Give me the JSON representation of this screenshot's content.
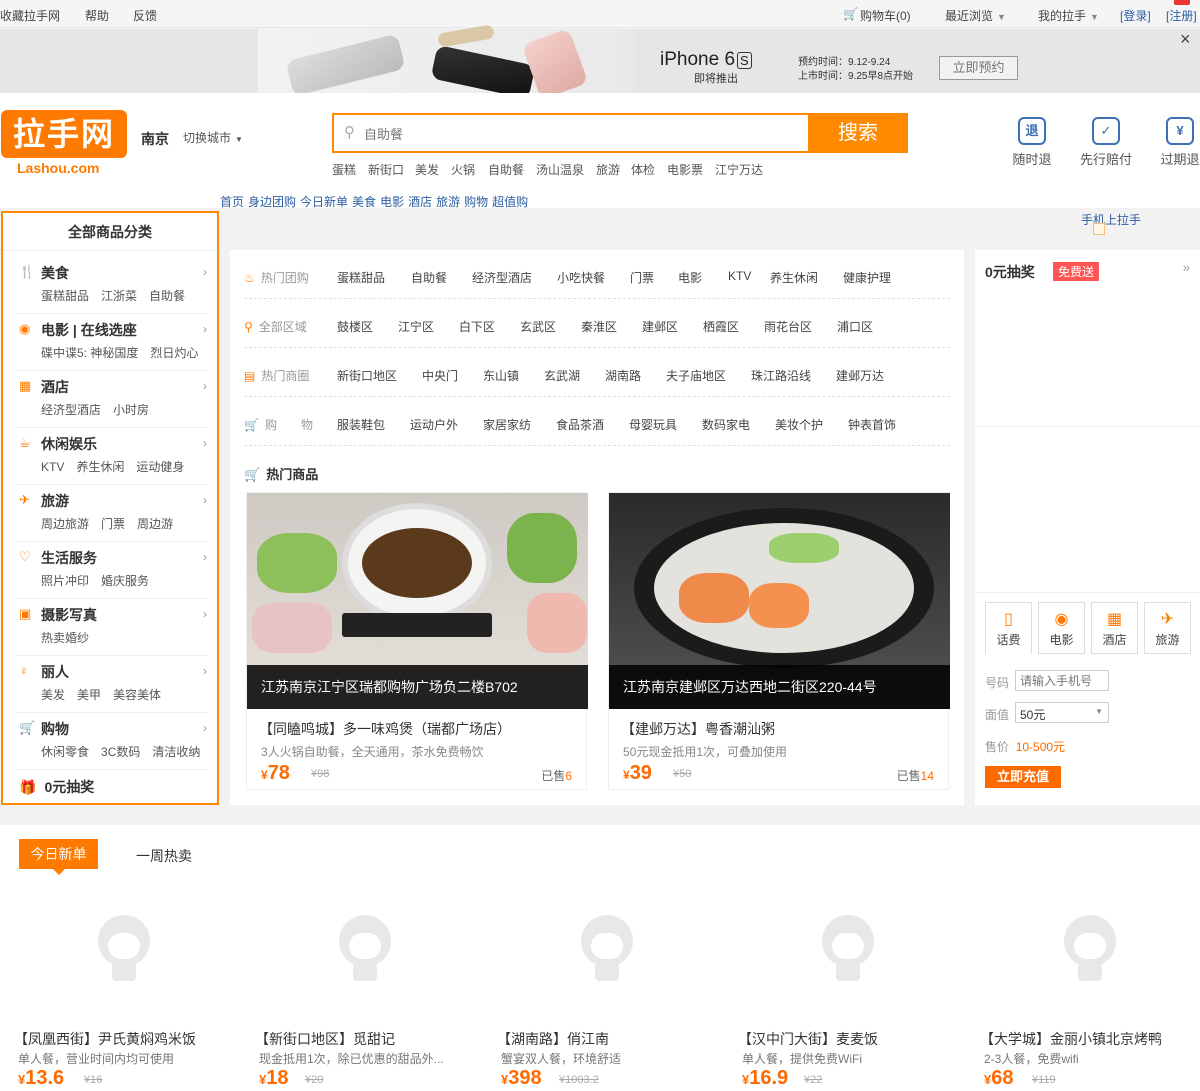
{
  "topbar": {
    "fav": "收藏拉手网",
    "help": "帮助",
    "feedback": "反馈",
    "cart": "购物车(0)",
    "recent": "最近浏览",
    "mine": "我的拉手",
    "login": "[登录]",
    "register": "[注册]",
    "close": "×"
  },
  "banner": {
    "phone": "iPhone 6",
    "phone_s": "S",
    "launch": "即将推出",
    "pre": "预约时间：9.12-9.24",
    "sale": "上市时间：9.25早8点开始",
    "reserve": "立即预约"
  },
  "logo": {
    "mark": "拉手网",
    "sub": "Lashou.com"
  },
  "city": {
    "name": "南京",
    "switch": "切换城市"
  },
  "search": {
    "placeholder": "自助餐",
    "button": "搜索"
  },
  "hot_keywords": [
    "蛋糕",
    "新街口",
    "美发",
    "火锅",
    "自助餐",
    "汤山温泉",
    "旅游",
    "体检",
    "电影票",
    "江宁万达"
  ],
  "nav": [
    "首页",
    "身边团购",
    "今日新单",
    "美食",
    "电影",
    "酒店",
    "旅游",
    "购物",
    "超值购"
  ],
  "guarantees": [
    "随时退",
    "先行赔付",
    "过期退"
  ],
  "mobile_link": "手机上拉手",
  "sidebar": {
    "title": "全部商品分类",
    "cats": [
      {
        "name": "美食",
        "subs": [
          "蛋糕甜品",
          "江浙菜",
          "自助餐"
        ]
      },
      {
        "name": "电影 | 在线选座",
        "subs": [
          "碟中谍5: 神秘国度",
          "烈日灼心"
        ]
      },
      {
        "name": "酒店",
        "subs": [
          "经济型酒店",
          "小时房"
        ]
      },
      {
        "name": "休闲娱乐",
        "subs": [
          "KTV",
          "养生休闲",
          "运动健身"
        ]
      },
      {
        "name": "旅游",
        "subs": [
          "周边旅游",
          "门票",
          "周边游"
        ]
      },
      {
        "name": "生活服务",
        "subs": [
          "照片冲印",
          "婚庆服务"
        ]
      },
      {
        "name": "摄影写真",
        "subs": [
          "热卖婚纱"
        ]
      },
      {
        "name": "丽人",
        "subs": [
          "美发",
          "美甲",
          "美容美体"
        ]
      },
      {
        "name": "购物",
        "subs": [
          "休闲零食",
          "3C数码",
          "清洁收纳"
        ]
      }
    ],
    "lottery": "0元抽奖"
  },
  "filters": [
    {
      "label": "热门团购",
      "items": [
        "蛋糕甜品",
        "自助餐",
        "经济型酒店",
        "小吃快餐",
        "门票",
        "电影",
        "KTV",
        "养生休闲",
        "健康护理"
      ]
    },
    {
      "label": "全部区域",
      "items": [
        "鼓楼区",
        "江宁区",
        "白下区",
        "玄武区",
        "秦淮区",
        "建邺区",
        "栖霞区",
        "雨花台区",
        "浦口区"
      ]
    },
    {
      "label": "热门商圈",
      "items": [
        "新街口地区",
        "中央门",
        "东山镇",
        "玄武湖",
        "湖南路",
        "夫子庙地区",
        "珠江路沿线",
        "建邺万达"
      ]
    },
    {
      "label": "购　　物",
      "items": [
        "服装鞋包",
        "运动户外",
        "家居家纺",
        "食品茶酒",
        "母婴玩具",
        "数码家电",
        "美妆个护",
        "钟表首饰"
      ]
    }
  ],
  "hot_goods_title": "热门商品",
  "hot_goods": [
    {
      "caption": "江苏南京江宁区瑞都购物广场负二楼B702",
      "title": "【同瞌鸣城】多一味鸡煲（瑞都广场店）",
      "desc": "3人火锅自助餐，全天通用，茶水免费畅饮",
      "price": "78",
      "orig": "¥98",
      "sold_label": "已售",
      "sold": "6"
    },
    {
      "caption": "江苏南京建邺区万达西地二街区220-44号",
      "title": "【建邺万达】粤香潮汕粥",
      "desc": "50元现金抵用1次，可叠加使用",
      "price": "39",
      "orig": "¥50",
      "sold_label": "已售",
      "sold": "14"
    }
  ],
  "right": {
    "title": "0元抽奖",
    "tag": "免费送",
    "tabs": [
      "话费",
      "电影",
      "酒店",
      "旅游"
    ],
    "num_label": "号码",
    "num_placeholder": "请输入手机号",
    "value_label": "面值",
    "value": "50元",
    "price_label": "售价",
    "price": "10-500元",
    "charge": "立即充值"
  },
  "bottom": {
    "tab_new": "今日新单",
    "tab_hot": "一周热卖",
    "products": [
      {
        "title": "【凤凰西街】尹氏黄焖鸡米饭",
        "desc": "单人餐，营业时间内均可使用",
        "price": "13.6",
        "orig": "¥16"
      },
      {
        "title": "【新街口地区】觅甜记",
        "desc": "现金抵用1次，除已优惠的甜品外...",
        "price": "18",
        "orig": "¥20"
      },
      {
        "title": "【湖南路】俏江南",
        "desc": "蟹宴双人餐，环境舒适",
        "price": "398",
        "orig": "¥1003.2"
      },
      {
        "title": "【汉中门大街】麦麦饭",
        "desc": "单人餐，提供免费WiFi",
        "price": "16.9",
        "orig": "¥22"
      },
      {
        "title": "【大学城】金丽小镇北京烤鸭",
        "desc": "2-3人餐，免费wifi",
        "price": "68",
        "orig": "¥119"
      }
    ]
  },
  "currency": "¥",
  "colors": {
    "accent": "#ff7a00",
    "link": "#2d5ea3",
    "price": "#ff6a00"
  }
}
